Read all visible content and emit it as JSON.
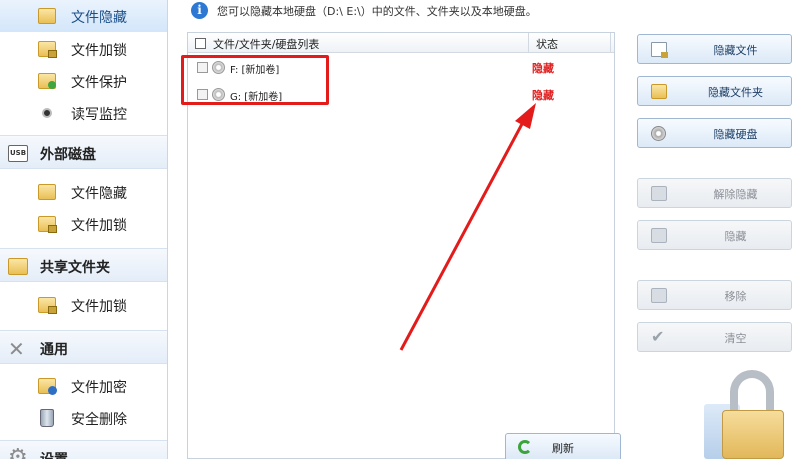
{
  "sidebar": {
    "items": [
      {
        "label": "文件隐藏",
        "icon": "folder-hide-icon",
        "active": true
      },
      {
        "label": "文件加锁",
        "icon": "folder-lock-icon"
      },
      {
        "label": "文件保护",
        "icon": "folder-protect-icon"
      },
      {
        "label": "读写监控",
        "icon": "monitor-dot-icon"
      }
    ],
    "external_disk": {
      "label": "外部磁盘",
      "icon": "usb-icon",
      "items": [
        {
          "label": "文件隐藏",
          "icon": "folder-hide-icon"
        },
        {
          "label": "文件加锁",
          "icon": "folder-lock-icon"
        }
      ]
    },
    "shared_folder": {
      "label": "共享文件夹",
      "icon": "shared-folder-icon",
      "items": [
        {
          "label": "文件加锁",
          "icon": "folder-lock-icon"
        }
      ]
    },
    "general": {
      "label": "通用",
      "icon": "tools-icon",
      "items": [
        {
          "label": "文件加密",
          "icon": "folder-encrypt-icon"
        },
        {
          "label": "安全删除",
          "icon": "trash-bin-icon"
        }
      ]
    },
    "settings": {
      "label": "设置",
      "icon": "gear-icon"
    }
  },
  "info": {
    "icon": "info-icon",
    "glyph": "i",
    "text": "您可以隐藏本地硬盘（D:\\ E:\\）中的文件、文件夹以及本地硬盘。"
  },
  "list": {
    "columns": [
      "文件/文件夹/硬盘列表",
      "状态"
    ],
    "rows": [
      {
        "name": "F: [新加卷]",
        "status": "隐藏",
        "icon": "disk-icon"
      },
      {
        "name": "G: [新加卷]",
        "status": "隐藏",
        "icon": "disk-icon"
      }
    ]
  },
  "buttons": {
    "hide_file": "隐藏文件",
    "hide_folder": "隐藏文件夹",
    "hide_disk": "隐藏硬盘",
    "unhide": "解除隐藏",
    "hide": "隐藏",
    "remove": "移除",
    "clear": "清空",
    "refresh": "刷新"
  },
  "colors": {
    "accent": "#2d78d2",
    "status_red": "#e02020",
    "annotation_red": "#e31b1b"
  }
}
